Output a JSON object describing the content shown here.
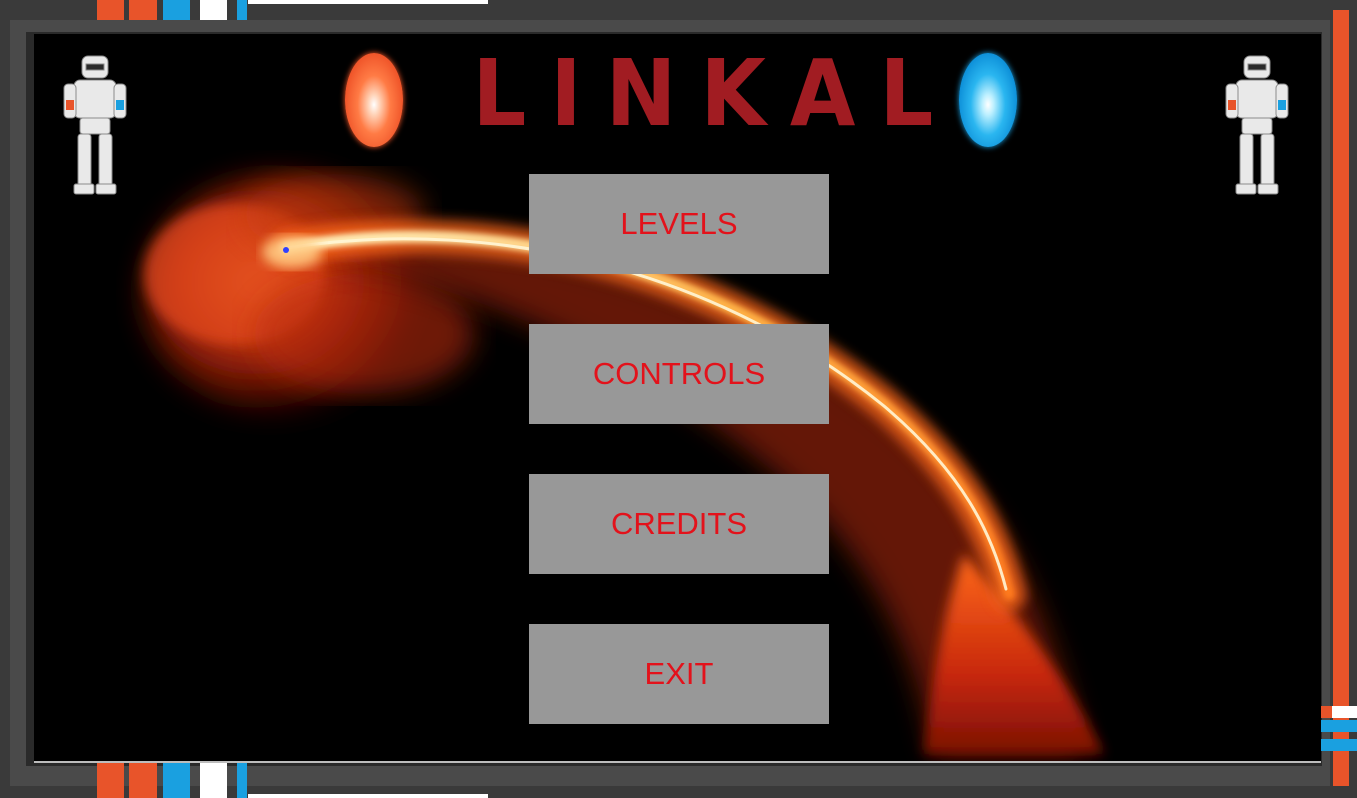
{
  "game": {
    "title": "LINKAL"
  },
  "menu": {
    "levels_label": "LEVELS",
    "controls_label": "CONTROLS",
    "credits_label": "CREDITS",
    "exit_label": "EXIT"
  },
  "colors": {
    "title_red": "#a11c22",
    "button_text_red": "#e3121b",
    "button_gray": "#989898",
    "portal_orange": "#f0562a",
    "portal_blue": "#1aa0e0",
    "frame_gray": "#3a3a3a"
  },
  "icons": {
    "left_portal": "orange-portal-icon",
    "right_portal": "blue-portal-icon",
    "left_character": "robot-character-icon",
    "right_character": "robot-character-icon"
  }
}
